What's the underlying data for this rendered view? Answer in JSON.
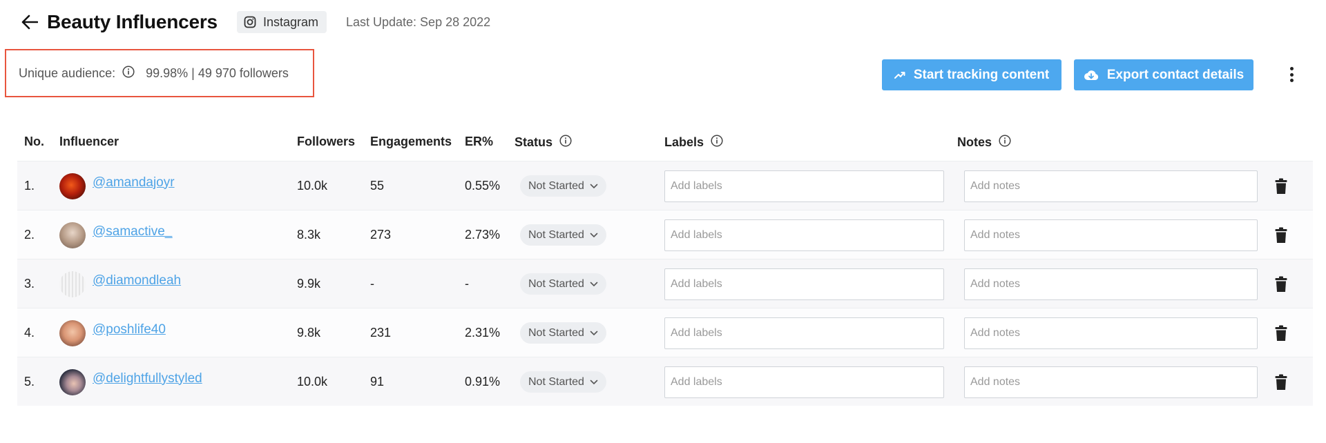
{
  "header": {
    "title": "Beauty Influencers",
    "platform": "Instagram",
    "last_update": "Last Update: Sep 28 2022"
  },
  "audience": {
    "label": "Unique audience:",
    "value": "99.98% | 49 970 followers"
  },
  "actions": {
    "track_label": "Start tracking content",
    "export_label": "Export contact details"
  },
  "table": {
    "columns": {
      "no": "No.",
      "influencer": "Influencer",
      "followers": "Followers",
      "engagements": "Engagements",
      "er": "ER%",
      "status": "Status",
      "labels": "Labels",
      "notes": "Notes"
    },
    "rows": [
      {
        "no": "1.",
        "handle": "@amandajoyr",
        "followers": "10.0k",
        "engagements": "55",
        "er": "0.55%",
        "status": "Not Started",
        "labels_placeholder": "Add labels",
        "notes_placeholder": "Add notes"
      },
      {
        "no": "2.",
        "handle": "@samactive_",
        "followers": "8.3k",
        "engagements": "273",
        "er": "2.73%",
        "status": "Not Started",
        "labels_placeholder": "Add labels",
        "notes_placeholder": "Add notes"
      },
      {
        "no": "3.",
        "handle": "@diamondleah",
        "followers": "9.9k",
        "engagements": "-",
        "er": "-",
        "status": "Not Started",
        "labels_placeholder": "Add labels",
        "notes_placeholder": "Add notes"
      },
      {
        "no": "4.",
        "handle": "@poshlife40",
        "followers": "9.8k",
        "engagements": "231",
        "er": "2.31%",
        "status": "Not Started",
        "labels_placeholder": "Add labels",
        "notes_placeholder": "Add notes"
      },
      {
        "no": "5.",
        "handle": "@delightfullystyled",
        "followers": "10.0k",
        "engagements": "91",
        "er": "0.91%",
        "status": "Not Started",
        "labels_placeholder": "Add labels",
        "notes_placeholder": "Add notes"
      }
    ]
  },
  "colors": {
    "accent": "#4da8ef",
    "link": "#4ea3e6",
    "highlight_border": "#e8553e"
  },
  "icons": {
    "back": "arrow-left-icon",
    "platform": "instagram-icon",
    "info": "info-icon",
    "track": "trending-up-icon",
    "export": "cloud-download-icon",
    "more": "kebab-menu-icon",
    "status": "chevron-down-icon",
    "delete": "trash-icon"
  }
}
